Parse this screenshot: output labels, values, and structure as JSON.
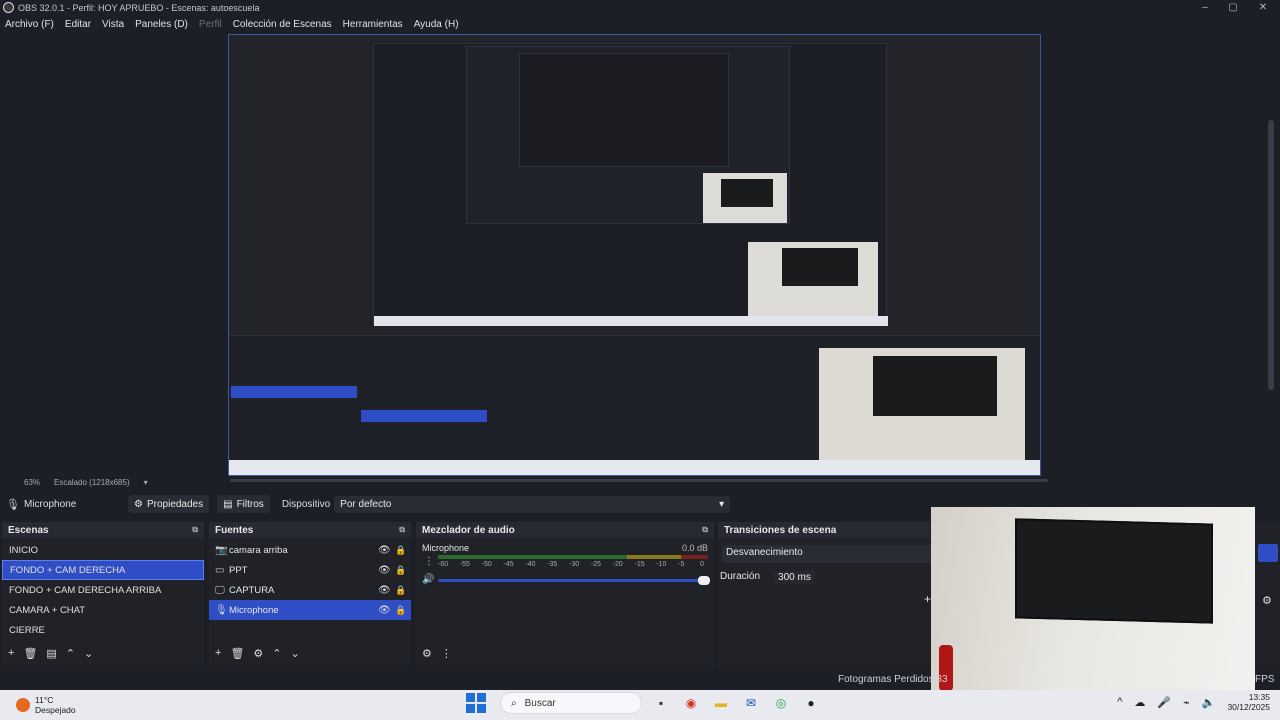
{
  "window": {
    "title": "OBS 32.0.1 - Perfil: HOY APRUEBO - Escenas: autoescuela",
    "controls": [
      "–",
      "▢",
      "✕"
    ]
  },
  "menu": [
    "Archivo (F)",
    "Editar",
    "Vista",
    "Paneles (D)",
    "Perfil",
    "Colección de Escenas",
    "Herramientas",
    "Ayuda (H)"
  ],
  "status": {
    "zoom": "63%",
    "scale": "Escalado (1218x685)"
  },
  "properties_bar": {
    "source": "Microphone",
    "properties_label": "Propiedades",
    "filters_label": "Filtros",
    "device_label": "Dispositivo",
    "device_value": "Por defecto"
  },
  "scenes": {
    "title": "Escenas",
    "items": [
      "INICIO",
      "FONDO + CAM DERECHA",
      "FONDO + CAM DERECHA ARRIBA",
      "CAMARA + CHAT",
      "CIERRE"
    ],
    "selected_index": 1
  },
  "sources": {
    "title": "Fuentes",
    "items": [
      {
        "name": "camara arriba",
        "icon": "camera-icon"
      },
      {
        "name": "PPT",
        "icon": "window-icon"
      },
      {
        "name": "CAPTURA",
        "icon": "monitor-icon"
      },
      {
        "name": "Microphone",
        "icon": "microphone-icon"
      }
    ],
    "selected_index": 3
  },
  "mixer": {
    "title": "Mezclador de audio",
    "channel": "Microphone",
    "db": "0.0 dB",
    "ticks": [
      "-60",
      "-55",
      "-50",
      "-45",
      "-40",
      "-35",
      "-30",
      "-25",
      "-20",
      "-15",
      "-10",
      "-5",
      "0"
    ],
    "volume": 1.0
  },
  "transitions": {
    "title": "Transiciones de escena",
    "selected": "Desvanecimiento",
    "duration_label": "Duración",
    "duration_value": "300 ms"
  },
  "footer": {
    "dropped": "Fotogramas Perdidos 33",
    "fps": "FPS"
  },
  "taskbar": {
    "weather_temp": "11°C",
    "weather_desc": "Despejado",
    "search_placeholder": "Buscar",
    "time": "13:35",
    "date": "30/12/2025"
  },
  "colors": {
    "accent": "#2f4dc4",
    "bg": "#1d1f26",
    "dock": "#202228"
  }
}
